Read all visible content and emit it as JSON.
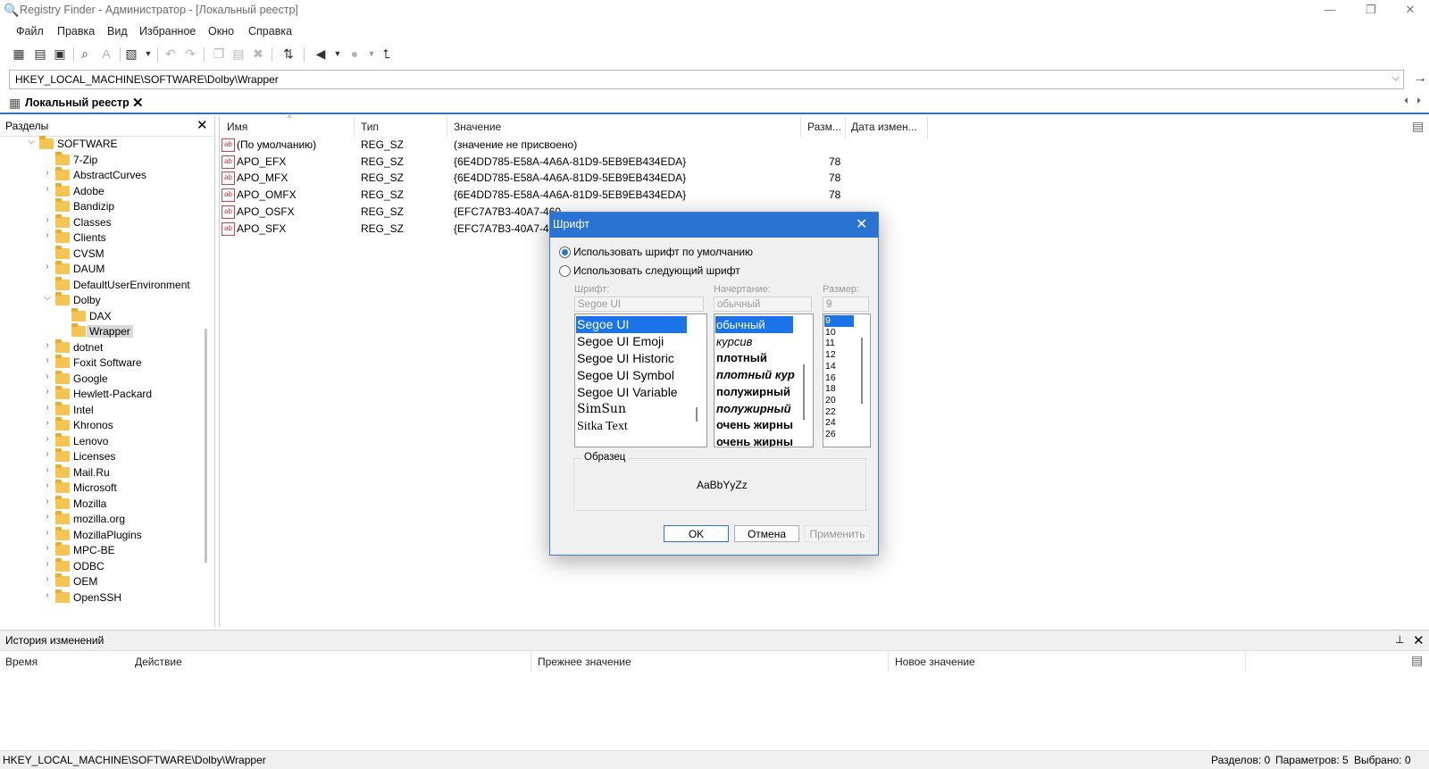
{
  "window": {
    "title": "Registry Finder - Администратор - [Локальный реестр]",
    "controls": {
      "minimize": "—",
      "maximize": "❐",
      "close": "✕"
    }
  },
  "menu": [
    "Файл",
    "Правка",
    "Вид",
    "Избранное",
    "Окно",
    "Справка"
  ],
  "toolbar": {
    "icons": [
      "grid-icon",
      "grid-list-icon",
      "save-icon",
      "find-icon",
      "find-text-icon",
      "export-icon",
      "undo-icon",
      "redo-icon",
      "copy-icon",
      "paste-icon",
      "delete-icon",
      "refresh-icon",
      "back-icon",
      "forward-icon",
      "up-icon"
    ]
  },
  "address": {
    "path": "HKEY_LOCAL_MACHINE\\SOFTWARE\\Dolby\\Wrapper",
    "go": "→"
  },
  "doc_tab": {
    "label": "Локальный реестр",
    "close": "✕"
  },
  "nav_arrows": {
    "left": "⏴",
    "right": "⏵"
  },
  "left_pane": {
    "title": "Разделы",
    "close": "✕",
    "tree": [
      {
        "label": "SOFTWARE",
        "expanded": true,
        "level": 0
      },
      {
        "label": "7-Zip",
        "level": 1,
        "has_children": false
      },
      {
        "label": "AbstractCurves",
        "level": 1,
        "has_children": true
      },
      {
        "label": "Adobe",
        "level": 1,
        "has_children": true
      },
      {
        "label": "Bandizip",
        "level": 1,
        "has_children": false
      },
      {
        "label": "Classes",
        "level": 1,
        "has_children": true
      },
      {
        "label": "Clients",
        "level": 1,
        "has_children": true
      },
      {
        "label": "CVSM",
        "level": 1,
        "has_children": false
      },
      {
        "label": "DAUM",
        "level": 1,
        "has_children": true
      },
      {
        "label": "DefaultUserEnvironment",
        "level": 1,
        "has_children": false
      },
      {
        "label": "Dolby",
        "level": 1,
        "expanded": true
      },
      {
        "label": "DAX",
        "level": 2,
        "has_children": false
      },
      {
        "label": "Wrapper",
        "level": 2,
        "selected": true
      },
      {
        "label": "dotnet",
        "level": 1,
        "has_children": true
      },
      {
        "label": "Foxit Software",
        "level": 1,
        "has_children": true
      },
      {
        "label": "Google",
        "level": 1,
        "has_children": true
      },
      {
        "label": "Hewlett-Packard",
        "level": 1,
        "has_children": true
      },
      {
        "label": "Intel",
        "level": 1,
        "has_children": true
      },
      {
        "label": "Khronos",
        "level": 1,
        "has_children": true
      },
      {
        "label": "Lenovo",
        "level": 1,
        "has_children": true
      },
      {
        "label": "Licenses",
        "level": 1,
        "has_children": true
      },
      {
        "label": "Mail.Ru",
        "level": 1,
        "has_children": true
      },
      {
        "label": "Microsoft",
        "level": 1,
        "has_children": true
      },
      {
        "label": "Mozilla",
        "level": 1,
        "has_children": true
      },
      {
        "label": "mozilla.org",
        "level": 1,
        "has_children": true
      },
      {
        "label": "MozillaPlugins",
        "level": 1,
        "has_children": true
      },
      {
        "label": "MPC-BE",
        "level": 1,
        "has_children": true
      },
      {
        "label": "ODBC",
        "level": 1,
        "has_children": true
      },
      {
        "label": "OEM",
        "level": 1,
        "has_children": true
      },
      {
        "label": "OpenSSH",
        "level": 1,
        "has_children": true
      }
    ]
  },
  "values_pane": {
    "columns": [
      "Имя",
      "Тип",
      "Значение",
      "Разм...",
      "Дата измен..."
    ],
    "rows": [
      {
        "name": "(По умолчанию)",
        "type": "REG_SZ",
        "value": "(значение не присвоено)",
        "size": ""
      },
      {
        "name": "APO_EFX",
        "type": "REG_SZ",
        "value": "{6E4DD785-E58A-4A6A-81D9-5EB9EB434EDA}",
        "size": "78"
      },
      {
        "name": "APO_MFX",
        "type": "REG_SZ",
        "value": "{6E4DD785-E58A-4A6A-81D9-5EB9EB434EDA}",
        "size": "78"
      },
      {
        "name": "APO_OMFX",
        "type": "REG_SZ",
        "value": "{6E4DD785-E58A-4A6A-81D9-5EB9EB434EDA}",
        "size": "78"
      },
      {
        "name": "APO_OSFX",
        "type": "REG_SZ",
        "value": "{EFC7A7B3-40A7-460",
        "size": ""
      },
      {
        "name": "APO_SFX",
        "type": "REG_SZ",
        "value": "{EFC7A7B3-40A7-460",
        "size": ""
      }
    ],
    "abicon_text": "ab"
  },
  "history": {
    "title": "История изменений",
    "columns": [
      "Время",
      "Действие",
      "Прежнее значение",
      "Новое значение"
    ],
    "pin": "📌",
    "close": "✕"
  },
  "status": {
    "path": "HKEY_LOCAL_MACHINE\\SOFTWARE\\Dolby\\Wrapper",
    "sections": "Разделов: 0",
    "params": "Параметров: 5",
    "selected": "Выбрано: 0"
  },
  "font_dialog": {
    "title": "Шрифт",
    "close": "✕",
    "radio_default": "Использовать шрифт по умолчанию",
    "radio_custom": "Использовать следующий шрифт",
    "font_label": "Шрифт:",
    "style_label": "Начертание:",
    "size_label": "Размер:",
    "font_value": "Segoe UI",
    "style_value": "обычный",
    "size_value": "9",
    "fonts": [
      "Segoe UI",
      "Segoe UI Emoji",
      "Segoe UI Historic",
      "Segoe UI Symbol",
      "Segoe UI Variable",
      "SimSun",
      "Sitka Text"
    ],
    "styles": [
      "обычный",
      "курсив",
      "плотный",
      "плотный кур",
      "полужирный",
      "полужирный",
      "очень жирны",
      "очень жирны"
    ],
    "sizes": [
      "9",
      "10",
      "11",
      "12",
      "14",
      "16",
      "18",
      "20",
      "22",
      "24",
      "26"
    ],
    "sample_label": "Образец",
    "sample_text": "AaBbYyZz",
    "ok": "OK",
    "cancel": "Отмена",
    "apply": "Применить"
  }
}
